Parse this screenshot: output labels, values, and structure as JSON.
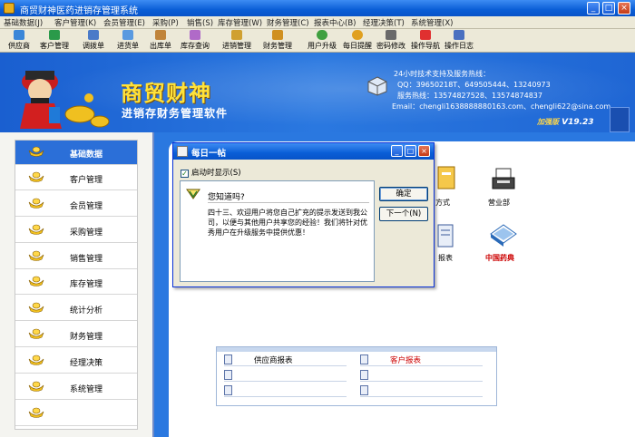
{
  "window": {
    "title": "商贸财神医药进销存管理系统",
    "controls": [
      "_",
      "□",
      "×"
    ]
  },
  "menu": [
    "基础数据(J)",
    "客户管理(K)",
    "会员管理(E)",
    "采购(P)",
    "销售(S)",
    "库存管理(W)",
    "财务管理(C)",
    "报表中心(B)",
    "经理决策(T)",
    "系统管理(X)"
  ],
  "toolbar": [
    {
      "label": "供应商",
      "icon": "supplier-icon",
      "color": "#3a86d8"
    },
    {
      "label": "客户管理",
      "icon": "customer-icon",
      "color": "#2a9a4a"
    },
    {
      "label": "调拨单",
      "icon": "transfer-icon",
      "color": "#4a7ac8"
    },
    {
      "label": "进货单",
      "icon": "purchase-icon",
      "color": "#5a9ae0"
    },
    {
      "label": "出库单",
      "icon": "outbound-icon",
      "color": "#c0843a"
    },
    {
      "label": "库存查询",
      "icon": "inventory-icon",
      "color": "#b06ac8"
    },
    {
      "label": "进销管理",
      "icon": "trade-icon",
      "color": "#d0a030"
    },
    {
      "label": "财务管理",
      "icon": "finance-icon",
      "color": "#d09020"
    },
    {
      "label": "用户升级",
      "icon": "upgrade-icon",
      "color": "#40a040"
    },
    {
      "label": "每日提醒",
      "icon": "reminder-icon",
      "color": "#e0a020"
    },
    {
      "label": "密码修改",
      "icon": "password-icon",
      "color": "#6a6a6a"
    },
    {
      "label": "操作导航",
      "icon": "navigation-icon",
      "color": "#e03030"
    },
    {
      "label": "操作日志",
      "icon": "log-icon",
      "color": "#4a70c0"
    }
  ],
  "banner": {
    "brand": "商贸财神",
    "subtitle": "进销存财务管理软件",
    "support_title": "24小时技术支持及服务热线：",
    "qq": "QQ：39650218T、649505444、13240973",
    "hotline": "服务热线：13574827528、13574874837",
    "email": "Email：chengli1638888880163.com、chengli622@sina.com",
    "edition": "加强版",
    "version": "V19.23"
  },
  "nav": [
    {
      "label": "基础数据",
      "active": true
    },
    {
      "label": "客户管理"
    },
    {
      "label": "会员管理"
    },
    {
      "label": "采购管理"
    },
    {
      "label": "销售管理"
    },
    {
      "label": "库存管理"
    },
    {
      "label": "统计分析"
    },
    {
      "label": "财务管理"
    },
    {
      "label": "经理决策"
    },
    {
      "label": "系统管理"
    },
    {
      "label": ""
    }
  ],
  "launchers": {
    "payment": "方式",
    "shop": "营业部",
    "report": "报表",
    "pharma": "中国药典"
  },
  "reports": {
    "supplier": "供应商报表",
    "customer": "客户报表"
  },
  "dialog": {
    "title": "每日一帖",
    "startup_label": "启动时显示(S)",
    "question": "您知道吗?",
    "tip": "四十三、欢迎用户将您自己扩充的提示发送到我公司，以便与其他用户共享您的经验！我们将针对优秀用户在升级服务中提供优惠！",
    "ok": "确定",
    "next": "下一个(N)"
  }
}
